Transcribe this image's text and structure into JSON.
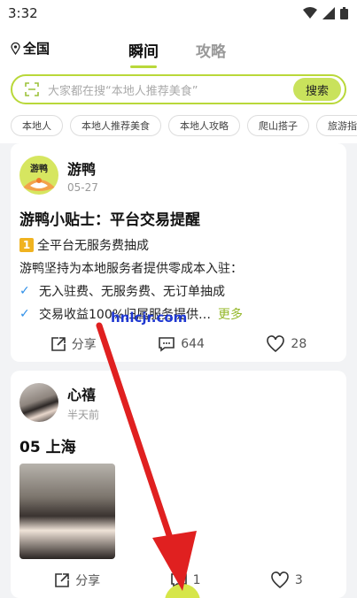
{
  "status_bar": {
    "time": "3:32"
  },
  "header": {
    "location": "全国",
    "tabs": [
      "瞬间",
      "攻略"
    ]
  },
  "search": {
    "placeholder": "大家都在搜“本地人推荐美食”",
    "button": "搜索"
  },
  "chips": [
    "本地人",
    "本地人推荐美食",
    "本地人攻略",
    "爬山搭子",
    "旅游指南"
  ],
  "posts": [
    {
      "author": "游鸭",
      "avatar_text": "游鸭",
      "time": "05-27",
      "title": "游鸭小贴士：平台交易提醒",
      "num": "1",
      "line1": "全平台无服务费抽成",
      "line2": "游鸭坚持为本地服务者提供零成本入驻：",
      "bullet1": "无入驻费、无服务费、无订单抽成",
      "bullet2": "交易收益100%归属服务提供…",
      "more": "更多",
      "share": "分享",
      "comments": "644",
      "likes": "28"
    },
    {
      "author": "心禧",
      "time": "半天前",
      "title": "05 上海",
      "share": "分享",
      "comments": "1",
      "likes": "3"
    }
  ],
  "watermark": "hnlcjr.com",
  "colors": {
    "accent": "#b9d83a",
    "arrow": "#e02020",
    "check": "#2f8fe8",
    "watermark": "#1e37d1"
  }
}
